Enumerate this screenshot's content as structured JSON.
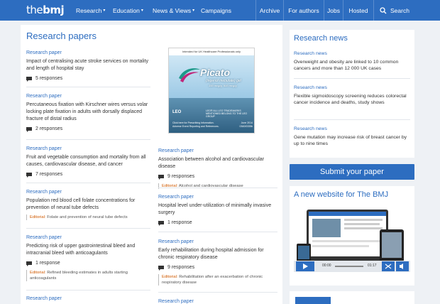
{
  "header": {
    "logo": {
      "prefix": "the",
      "name": "bmj"
    },
    "nav": [
      {
        "label": "Research",
        "caret": "▾"
      },
      {
        "label": "Education",
        "caret": "▾"
      },
      {
        "label": "News & Views",
        "caret": "▾"
      },
      {
        "label": "Campaigns",
        "caret": ""
      }
    ],
    "right_nav": [
      {
        "label": "Archive"
      },
      {
        "label": "For authors"
      },
      {
        "label": "Jobs"
      },
      {
        "label": "Hosted"
      }
    ],
    "search_label": "Search"
  },
  "main": {
    "title": "Research papers",
    "left_articles": [
      {
        "kicker": "Research paper",
        "title": "Impact of centralising acute stroke services on mortality and length of hospital stay",
        "responses": "5 responses"
      },
      {
        "kicker": "Research paper",
        "title": "Percutaneous fixation with Kirschner wires versus volar locking plate fixation in adults with dorsally displaced fracture of distal radius",
        "responses": "2 responses"
      },
      {
        "kicker": "Research paper",
        "title": "Fruit and vegetable consumption and mortality from all causes, cardiovascular disease, and cancer",
        "responses": "7 responses"
      },
      {
        "kicker": "Research paper",
        "title": "Population red blood cell folate concentrations for prevention of neural tube defects",
        "editorial_label": "Editorial:",
        "editorial_text": "Folate and prevention of neural tube defects"
      },
      {
        "kicker": "Research paper",
        "title": "Predicting risk of upper gastrointestinal bleed and intracranial bleed with anticoagulants",
        "responses": "1 response",
        "editorial_label": "Editorial:",
        "editorial_text": "Refined bleeding estimates in adults starting anticoagulants"
      },
      {
        "kicker": "Research paper"
      }
    ],
    "right_articles": [
      {
        "kicker": "Research paper",
        "title": "Association between alcohol and cardiovascular disease",
        "responses": "9 responses",
        "editorial_label": "Editorial:",
        "editorial_text": "Alcohol and cardiovascular disease"
      },
      {
        "kicker": "Research paper",
        "title": "Hospital level under-utilization of minimally invasive surgery",
        "responses": "1 response"
      },
      {
        "kicker": "Research paper",
        "title": "Early rehabilitation during hospital admission for chronic respiratory disease",
        "responses": "9 responses",
        "editorial_label": "Editorial:",
        "editorial_text": "Rehabilitation after an exacerbation of chronic respiratory disease"
      },
      {
        "kicker": "Research paper"
      }
    ]
  },
  "ad": {
    "top_text": "Intended for UK Healthcare Professionals only",
    "brand": "Picato",
    "sub": "(ingenol mebutate) gel",
    "dose": "150 mcg/g, 500 mcg/g",
    "company": "LEO",
    "licence": "LEO® ALL LEO TRADEMARKS MENTIONED BELONG TO THE LEO GROUP",
    "footer": "Click here for Prescribing Information. Adverse Event Reporting and References.",
    "code": "June 2014 0340/0335b"
  },
  "sidebar": {
    "research_news_title": "Research news",
    "news": [
      {
        "kicker": "Research news",
        "title": "Overweight and obesity are linked to 10 common cancers and more than 12 000 UK cases"
      },
      {
        "kicker": "Research news",
        "title": "Flexible sigmoidoscopy screening reduces colorectal cancer incidence and deaths, study shows"
      },
      {
        "kicker": "Research news",
        "title": "Gene mutation may increase risk of breast cancer by up to nine times"
      }
    ],
    "submit_label": "Submit your paper",
    "new_website_title": "A new website for The BMJ",
    "video": {
      "time_current": "00:00",
      "time_total": "01:17"
    }
  },
  "colors": {
    "brand_blue": "#2d6dc0",
    "editorial_orange": "#d05a00",
    "background": "#eef1f5"
  }
}
